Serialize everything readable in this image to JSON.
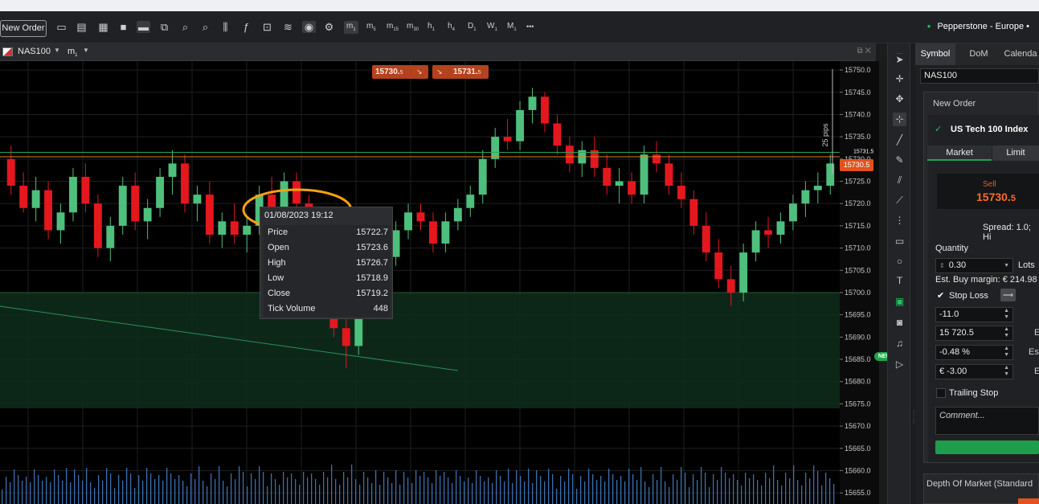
{
  "toolbar": {
    "new_order_label": "New Order",
    "timeframes": [
      {
        "base": "m",
        "sub": "1"
      },
      {
        "base": "m",
        "sub": "5"
      },
      {
        "base": "m",
        "sub": "15"
      },
      {
        "base": "m",
        "sub": "30"
      },
      {
        "base": "h",
        "sub": "1"
      },
      {
        "base": "h",
        "sub": "4"
      },
      {
        "base": "D",
        "sub": "1"
      },
      {
        "base": "W",
        "sub": "1"
      },
      {
        "base": "M",
        "sub": "1"
      }
    ],
    "more_label": "•••",
    "broker_label": "Pepperstone - Europe •"
  },
  "chart_header": {
    "symbol": "NAS100",
    "timeframe_base": "m",
    "timeframe_sub": "1"
  },
  "quotes": {
    "sell_main": "15730.",
    "sell_small": "5",
    "buy_main": "15731.",
    "buy_small": "5"
  },
  "price_badge": "15730.5",
  "new_badge": "NEW",
  "pips_label": "25 pips",
  "tooltip": {
    "date": "01/08/2023 19:12",
    "rows": [
      {
        "label": "Price",
        "value": "15722.7"
      },
      {
        "label": "Open",
        "value": "15723.6"
      },
      {
        "label": "High",
        "value": "15726.7"
      },
      {
        "label": "Low",
        "value": "15718.9"
      },
      {
        "label": "Close",
        "value": "15719.2"
      },
      {
        "label": "Tick Volume",
        "value": "448"
      }
    ]
  },
  "chart_data": {
    "type": "candlestick",
    "y_ticks": [
      15750.0,
      15745.0,
      15740.0,
      15735.0,
      15730.0,
      15725.0,
      15720.0,
      15715.0,
      15710.0,
      15705.0,
      15700.0,
      15695.0,
      15690.0,
      15685.0,
      15680.0,
      15675.0,
      15670.0,
      15665.0,
      15660.0,
      15655.0
    ],
    "y_tick_suffix": "0.",
    "ylim": [
      15652.5,
      15752.0
    ],
    "upper_tag_value": "15731.5",
    "current_price": 15730.5,
    "candles_ohlc": [
      [
        15730,
        15733,
        15722,
        15724
      ],
      [
        15724,
        15727,
        15718,
        15719
      ],
      [
        15719,
        15726,
        15716,
        15723
      ],
      [
        15723,
        15725,
        15712,
        15714
      ],
      [
        15714,
        15720,
        15711,
        15718
      ],
      [
        15718,
        15728,
        15716,
        15726
      ],
      [
        15726,
        15729,
        15718,
        15720
      ],
      [
        15720,
        15722,
        15708,
        15710
      ],
      [
        15710,
        15717,
        15707,
        15715
      ],
      [
        15715,
        15726,
        15713,
        15724
      ],
      [
        15724,
        15727,
        15714,
        15716
      ],
      [
        15716,
        15721,
        15712,
        15719
      ],
      [
        15719,
        15728,
        15717,
        15726
      ],
      [
        15726,
        15732,
        15722,
        15729
      ],
      [
        15729,
        15731,
        15718,
        15720
      ],
      [
        15720,
        15724,
        15716,
        15722
      ],
      [
        15722,
        15725,
        15711,
        15713
      ],
      [
        15713,
        15718,
        15710,
        15716
      ],
      [
        15716,
        15720,
        15711,
        15713
      ],
      [
        15713,
        15717,
        15709,
        15715
      ],
      [
        15715,
        15724,
        15713,
        15722
      ],
      [
        15722,
        15726,
        15719,
        15719
      ],
      [
        15719,
        15727,
        15717,
        15725
      ],
      [
        15725,
        15727,
        15719,
        15720
      ],
      [
        15720,
        15722,
        15706,
        15708
      ],
      [
        15708,
        15712,
        15698,
        15700
      ],
      [
        15700,
        15704,
        15690,
        15692
      ],
      [
        15692,
        15694,
        15683,
        15688
      ],
      [
        15688,
        15698,
        15686,
        15696
      ],
      [
        15696,
        15712,
        15694,
        15710
      ],
      [
        15710,
        15714,
        15706,
        15708
      ],
      [
        15708,
        15716,
        15706,
        15714
      ],
      [
        15714,
        15720,
        15712,
        15718
      ],
      [
        15718,
        15720,
        15714,
        15716
      ],
      [
        15716,
        15718,
        15709,
        15711
      ],
      [
        15711,
        15718,
        15709,
        15716
      ],
      [
        15716,
        15721,
        15714,
        15719
      ],
      [
        15719,
        15724,
        15717,
        15722
      ],
      [
        15722,
        15732,
        15720,
        15730
      ],
      [
        15730,
        15737,
        15728,
        15735
      ],
      [
        15735,
        15739,
        15732,
        15734
      ],
      [
        15734,
        15743,
        15732,
        15741
      ],
      [
        15741,
        15746,
        15738,
        15744
      ],
      [
        15744,
        15745,
        15736,
        15738
      ],
      [
        15738,
        15740,
        15731,
        15733
      ],
      [
        15733,
        15735,
        15727,
        15729
      ],
      [
        15729,
        15734,
        15726,
        15732
      ],
      [
        15732,
        15735,
        15726,
        15728
      ],
      [
        15728,
        15731,
        15722,
        15724
      ],
      [
        15724,
        15728,
        15720,
        15725
      ],
      [
        15725,
        15727,
        15720,
        15722
      ],
      [
        15722,
        15733,
        15720,
        15731
      ],
      [
        15731,
        15734,
        15727,
        15729
      ],
      [
        15729,
        15731,
        15722,
        15724
      ],
      [
        15724,
        15727,
        15719,
        15721
      ],
      [
        15721,
        15723,
        15713,
        15715
      ],
      [
        15715,
        15718,
        15707,
        15709
      ],
      [
        15709,
        15712,
        15701,
        15703
      ],
      [
        15703,
        15706,
        15697,
        15700
      ],
      [
        15700,
        15711,
        15698,
        15709
      ],
      [
        15709,
        15716,
        15707,
        15714
      ],
      [
        15714,
        15717,
        15710,
        15713
      ],
      [
        15713,
        15718,
        15711,
        15716
      ],
      [
        15716,
        15722,
        15714,
        15720
      ],
      [
        15720,
        15725,
        15717,
        15723
      ],
      [
        15723,
        15727,
        15720,
        15724
      ],
      [
        15724,
        15731,
        15722,
        15729
      ]
    ]
  },
  "drawing_tools": [
    "cursor",
    "crosshair",
    "move",
    "select-box",
    "trendline",
    "pen",
    "fib",
    "measure",
    "grid",
    "rect",
    "circle",
    "text",
    "rect-fill",
    "camera",
    "bell",
    "play"
  ],
  "panel": {
    "tabs": [
      "Symbol",
      "DoM",
      "Calenda"
    ],
    "symbol_value": "NAS100",
    "new_order_title": "New Order",
    "instrument": "US Tech 100 Index",
    "order_type_market": "Market",
    "order_type_limit": "Limit",
    "sell_label": "Sell",
    "sell_price_main": "15730.",
    "sell_price_small": "5",
    "spread_label": "Spread: 1.0; Hi",
    "quantity_label": "Quantity",
    "quantity_value": "0.30",
    "lots_label": "Lots",
    "est_margin": "Est. Buy margin: € 214.98",
    "stop_loss_label": "Stop Loss",
    "sl_pips": "-11.0",
    "sl_price": "15 720.5",
    "sl_percent": "-0.48 %",
    "sl_amount": "€ -3.00",
    "side_chars": [
      "E",
      "Es",
      "E"
    ],
    "trailing_stop_label": "Trailing Stop",
    "comment_placeholder": "Comment...",
    "dom_title": "Depth Of Market (Standard"
  }
}
